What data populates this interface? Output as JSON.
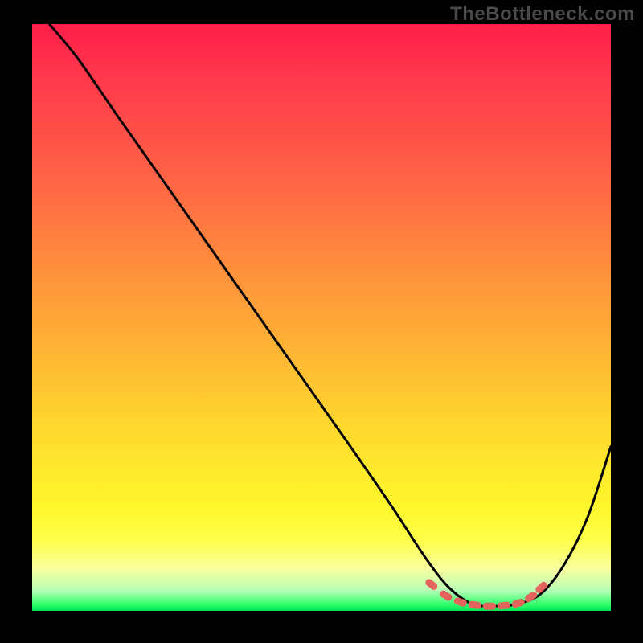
{
  "watermark": "TheBottleneck.com",
  "colors": {
    "background": "#000000",
    "curve": "#000000",
    "marker": "#e2645d",
    "watermark": "#4a4a4a"
  },
  "chart_data": {
    "type": "line",
    "title": "",
    "xlabel": "",
    "ylabel": "",
    "xlim": [
      0,
      100
    ],
    "ylim": [
      0,
      100
    ],
    "grid": false,
    "series": [
      {
        "name": "bottleneck-curve",
        "x": [
          3,
          8,
          15,
          25,
          35,
          45,
          55,
          62,
          68,
          72,
          76,
          80,
          84,
          88,
          92,
          96,
          100
        ],
        "y": [
          100,
          94,
          84,
          70,
          56,
          42,
          28,
          18,
          9,
          4,
          1.2,
          0.8,
          1.2,
          3,
          8,
          16,
          28
        ]
      }
    ],
    "markers": {
      "name": "optimal-range",
      "x": [
        69,
        71.5,
        74,
        76.5,
        79,
        81.5,
        84,
        86.2,
        88
      ],
      "y": [
        4.5,
        2.6,
        1.5,
        1.0,
        0.8,
        0.9,
        1.3,
        2.4,
        4.0
      ]
    }
  }
}
